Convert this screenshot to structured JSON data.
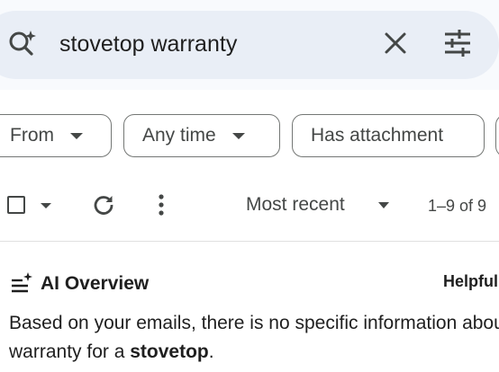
{
  "search": {
    "query": "stovetop warranty",
    "icons": {
      "leading": "search-sparkle-icon",
      "clear": "close-icon",
      "options": "tune-icon"
    }
  },
  "filters": {
    "chips": [
      {
        "label": "From",
        "has_caret": true
      },
      {
        "label": "Any time",
        "has_caret": true
      },
      {
        "label": "Has attachment",
        "has_caret": false
      }
    ]
  },
  "toolbar": {
    "sort_label": "Most recent",
    "page_count": "1–9 of 9",
    "icons": [
      "checkbox-icon",
      "chevron-down-icon",
      "refresh-icon",
      "more-vert-icon"
    ]
  },
  "ai_overview": {
    "title": "AI Overview",
    "helpful_label": "Helpful",
    "body_line1": "Based on your emails, there is no specific information about a",
    "body_line2_prefix": "warranty for a ",
    "body_line2_bold": "stovetop",
    "body_line2_suffix": "."
  },
  "colors": {
    "search_bar_bg": "#e9eef6",
    "page_bg": "#ffffff",
    "text_primary": "#1f1f1f",
    "text_secondary": "#444746",
    "chip_border": "#747775"
  }
}
